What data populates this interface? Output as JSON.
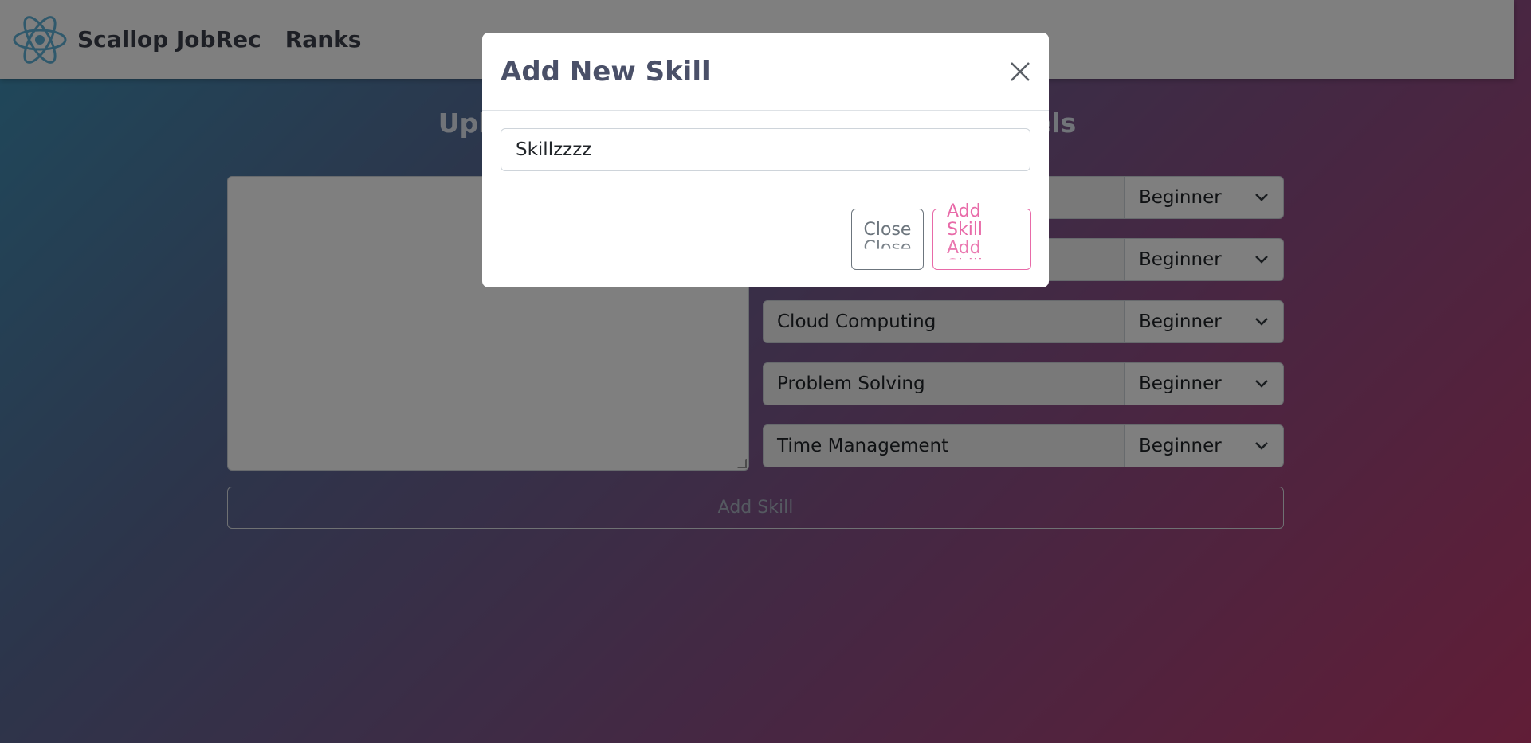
{
  "navbar": {
    "brand": "Scallop JobRec",
    "link": "Ranks"
  },
  "page": {
    "title": "Upload Job Description and Set Skill Levels",
    "skills": [
      {
        "name": "",
        "level": "Beginner"
      },
      {
        "name": "",
        "level": "Beginner"
      },
      {
        "name": "Cloud Computing",
        "level": "Beginner"
      },
      {
        "name": "Problem Solving",
        "level": "Beginner"
      },
      {
        "name": "Time Management",
        "level": "Beginner"
      }
    ],
    "add_skill_label": "Add Skill"
  },
  "modal": {
    "title": "Add New Skill",
    "input_value": "Skillzzzz",
    "close_label": "Close",
    "add_label": "Add Skill"
  },
  "colors": {
    "accent_pink": "#e86aa8",
    "react_logo": "#61b3d9"
  },
  "icons": {
    "logo": "react-atom-icon",
    "close": "close-icon",
    "dropdown": "chevron-down-icon"
  }
}
